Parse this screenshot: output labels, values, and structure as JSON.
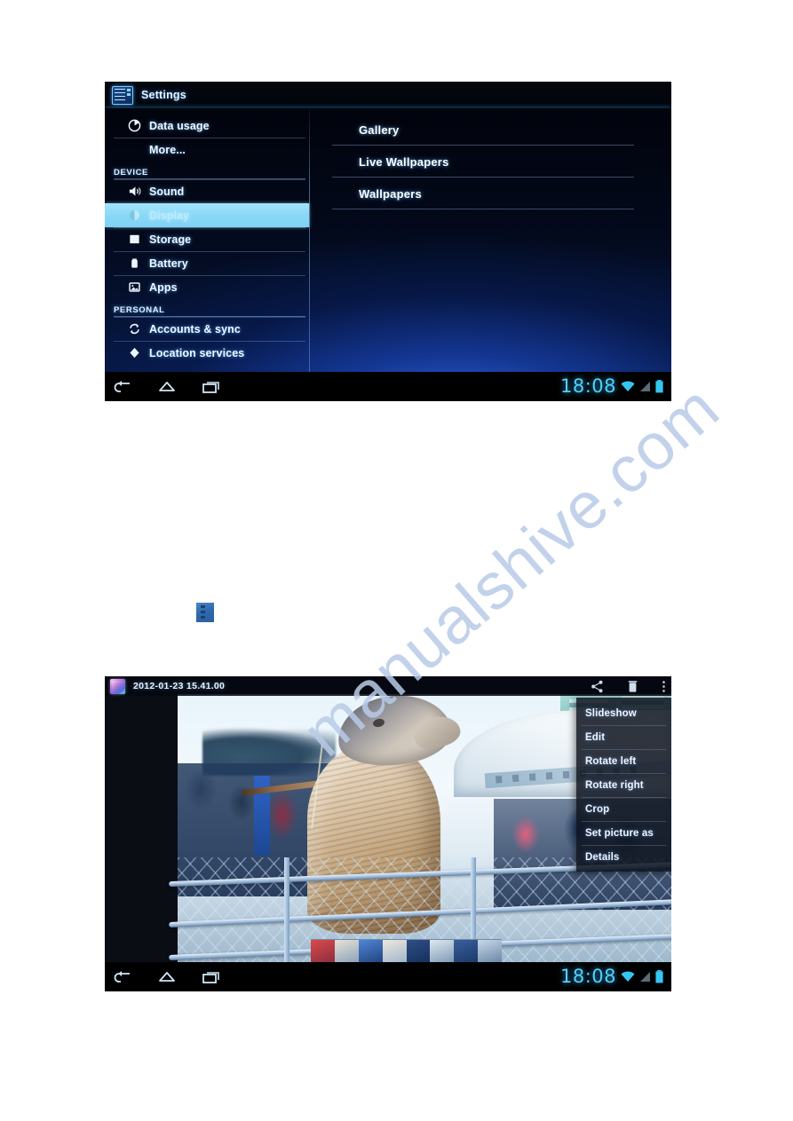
{
  "page": {
    "watermark": "manualshive.com"
  },
  "settings_screenshot": {
    "titlebar": {
      "app_icon": "settings-icon",
      "title": "Settings"
    },
    "left_panel": {
      "items": [
        {
          "label": "Data usage",
          "icon": "data-usage-icon",
          "type": "item",
          "selected": false
        },
        {
          "label": "More...",
          "icon": "none",
          "type": "item-noicon",
          "selected": false
        },
        {
          "label": "DEVICE",
          "icon": "none",
          "type": "section"
        },
        {
          "label": "Sound",
          "icon": "sound-icon",
          "type": "item",
          "selected": false
        },
        {
          "label": "Display",
          "icon": "display-icon",
          "type": "item",
          "selected": true
        },
        {
          "label": "Storage",
          "icon": "storage-icon",
          "type": "item",
          "selected": false
        },
        {
          "label": "Battery",
          "icon": "battery-icon",
          "type": "item",
          "selected": false
        },
        {
          "label": "Apps",
          "icon": "apps-icon",
          "type": "item",
          "selected": false
        },
        {
          "label": "PERSONAL",
          "icon": "none",
          "type": "section"
        },
        {
          "label": "Accounts & sync",
          "icon": "sync-icon",
          "type": "item",
          "selected": false
        },
        {
          "label": "Location services",
          "icon": "location-icon",
          "type": "item",
          "selected": false
        }
      ]
    },
    "right_panel": {
      "items": [
        {
          "label": "Gallery"
        },
        {
          "label": "Live Wallpapers"
        },
        {
          "label": "Wallpapers"
        }
      ]
    },
    "navbar": {
      "back": "back-icon",
      "home": "home-icon",
      "recents": "recent-apps-icon",
      "clock": "18:08",
      "wifi": "wifi-icon",
      "signal": "signal-icon",
      "battery": "battery-status-icon"
    }
  },
  "standalone_icon": {
    "name": "menu-overflow-icon"
  },
  "gallery_screenshot": {
    "topbar": {
      "app_icon": "gallery-icon",
      "title": "2012-01-23 15.41.00",
      "actions": [
        {
          "name": "share-icon"
        },
        {
          "name": "delete-icon"
        },
        {
          "name": "overflow-menu-icon"
        }
      ]
    },
    "overflow_menu": {
      "items": [
        {
          "label": "Slideshow"
        },
        {
          "label": "Edit"
        },
        {
          "label": "Rotate left"
        },
        {
          "label": "Rotate right"
        },
        {
          "label": "Crop"
        },
        {
          "label": "Set picture as"
        },
        {
          "label": "Details"
        }
      ]
    },
    "photo": {
      "description": "Camel standing behind a wire fence with a crowd and white tent"
    },
    "navbar": {
      "back": "back-icon",
      "home": "home-icon",
      "recents": "recent-apps-icon",
      "clock": "18:08",
      "wifi": "wifi-icon",
      "signal": "signal-icon",
      "battery": "battery-status-icon"
    }
  }
}
